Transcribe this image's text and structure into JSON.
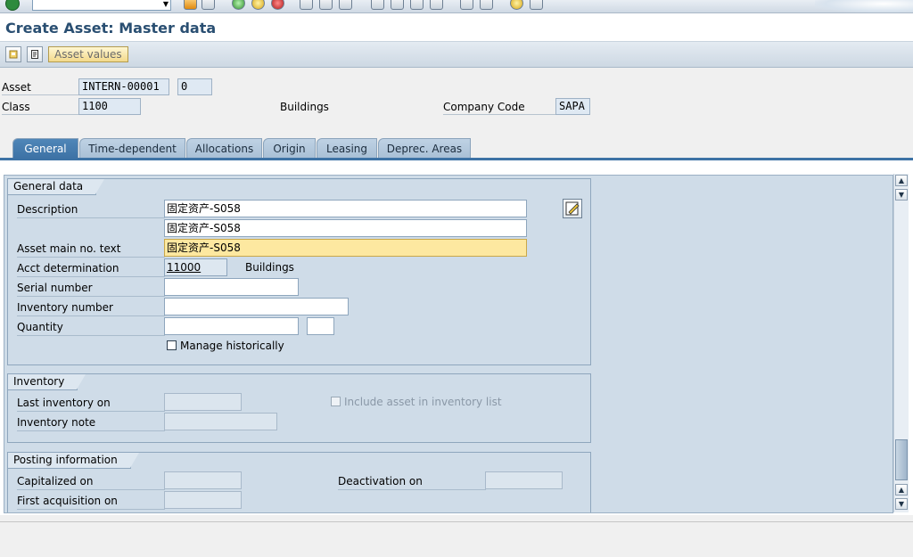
{
  "title": "Create Asset:  Master data",
  "toolbar": {
    "asset_values_label": "Asset values"
  },
  "header": {
    "asset_label": "Asset",
    "asset_number": "INTERN-00001",
    "asset_subnumber": "0",
    "class_label": "Class",
    "class_value": "1100",
    "class_text": "Buildings",
    "company_code_label": "Company Code",
    "company_code_value": "SAPA"
  },
  "tabs": [
    {
      "label": "General",
      "active": true
    },
    {
      "label": "Time-dependent",
      "active": false
    },
    {
      "label": "Allocations",
      "active": false
    },
    {
      "label": "Origin",
      "active": false
    },
    {
      "label": "Leasing",
      "active": false
    },
    {
      "label": "Deprec. Areas",
      "active": false
    }
  ],
  "general_data": {
    "title": "General data",
    "description_label": "Description",
    "description_1": "固定资产-S058",
    "description_2": "固定资产-S058",
    "asset_main_no_text_label": "Asset main no. text",
    "asset_main_no_text": "固定资产-S058",
    "acct_determination_label": "Acct determination",
    "acct_determination_value": "11000",
    "acct_determination_text": "Buildings",
    "serial_number_label": "Serial number",
    "serial_number_value": "",
    "inventory_number_label": "Inventory number",
    "inventory_number_value": "",
    "quantity_label": "Quantity",
    "quantity_value": "",
    "quantity_unit": "",
    "manage_historically_label": "Manage historically",
    "manage_historically_checked": false
  },
  "inventory": {
    "title": "Inventory",
    "last_inventory_label": "Last inventory on",
    "last_inventory_value": "",
    "inventory_note_label": "Inventory note",
    "inventory_note_value": "",
    "include_in_list_label": "Include asset in inventory list",
    "include_in_list_checked": false
  },
  "posting": {
    "title": "Posting information",
    "capitalized_label": "Capitalized on",
    "capitalized_value": "",
    "deactivation_label": "Deactivation on",
    "deactivation_value": "",
    "first_acquisition_label": "First acquisition on",
    "first_acquisition_value": ""
  },
  "colors": {
    "title_text": "#2a4f72",
    "tab_active": "#3d72a5",
    "panel_bg": "#cfdce8",
    "focus_field": "#fde8a0"
  },
  "icons": [
    "enter-icon",
    "save-icon",
    "back-icon",
    "exit-icon",
    "cancel-icon",
    "print-icon",
    "find-icon",
    "first-page-icon",
    "next-page-icon",
    "create-session-icon",
    "shortcut-icon",
    "help-icon",
    "layout-icon",
    "edit-icon",
    "other-asset-icon",
    "scroll-up-icon",
    "scroll-down-icon"
  ]
}
